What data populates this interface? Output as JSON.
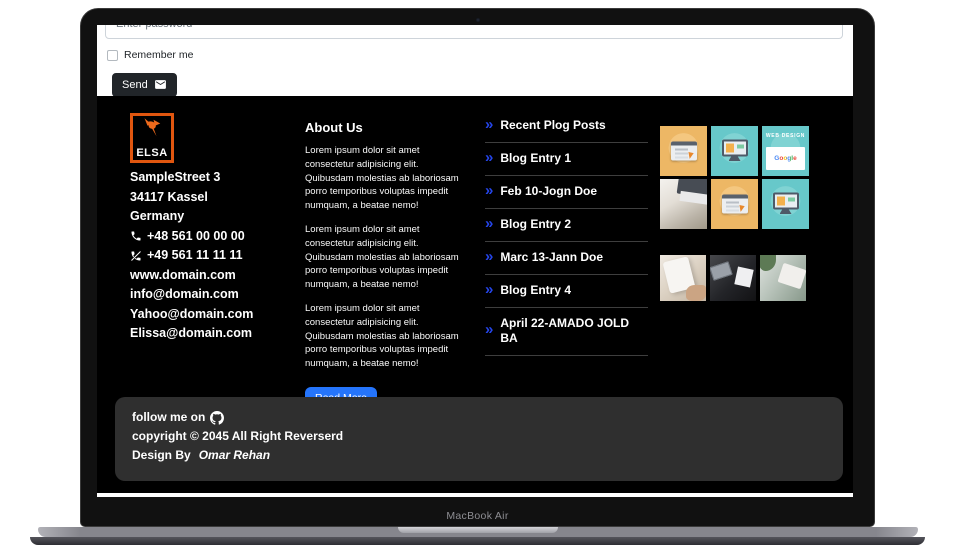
{
  "device": {
    "label": "MacBook Air"
  },
  "form": {
    "password_placeholder": "Enter password",
    "remember_label": "Remember me",
    "send_label": "Send"
  },
  "contact": {
    "logo_name": "ELSA",
    "address_lines": [
      "SampleStreet 3",
      "34117 Kassel",
      "Germany"
    ],
    "phones": [
      {
        "icon": "phone-icon",
        "number": "+48 561 00 00 00"
      },
      {
        "icon": "phone-slash-icon",
        "number": "+49 561 11 11 11"
      }
    ],
    "links": [
      "www.domain.com",
      "info@domain.com",
      "Yahoo@domain.com",
      "Elissa@domain.com"
    ]
  },
  "about": {
    "title": "About Us",
    "paragraphs": [
      "Lorem ipsum dolor sit amet consectetur adipisicing elit. Quibusdam molestias ab laboriosam porro temporibus voluptas impedit numquam, a beatae nemo!",
      "Lorem ipsum dolor sit amet consectetur adipisicing elit. Quibusdam molestias ab laboriosam porro temporibus voluptas impedit numquam, a beatae nemo!",
      "Lorem ipsum dolor sit amet consectetur adipisicing elit. Quibusdam molestias ab laboriosam porro temporibus voluptas impedit numquam, a beatae nemo!"
    ],
    "read_more_label": "Read More"
  },
  "recent_posts": {
    "title": "Recent Plog Posts",
    "items": [
      "Blog Entry 1",
      "Feb 10-Jogn Doe",
      "Blog Entry 2",
      "Marc 13-Jann Doe",
      "Blog Entry 4",
      "April 22-AMADO JOLD BA"
    ]
  },
  "gallery": {
    "web_design_label": "WEB DESIGN",
    "google_label": "Google",
    "thumbnails": [
      "browser-illustration-orange",
      "monitor-illustration-teal",
      "web-design-card-teal",
      "workspace-photo",
      "browser-illustration-orange",
      "monitor-illustration-teal",
      "writing-photo",
      "dark-desk-photo",
      "plant-desk-photo"
    ]
  },
  "footer_bar": {
    "follow_text": "follow me on",
    "copyright_text": "copyright © 2045 All Right Reverserd",
    "design_by_prefix": "Design By",
    "designer_name": "Omar Rehan"
  },
  "icons": {
    "double_chevron": "»"
  },
  "colors": {
    "accent_orange": "#e0560f",
    "chevron_blue": "#2546eb",
    "read_more_blue": "#2575fc",
    "tile_orange": "#edb765",
    "tile_teal": "#67c8ca",
    "footer_background": "#000000",
    "copyright_bar_background": "#2f2f2f",
    "send_button_background": "#212529"
  }
}
